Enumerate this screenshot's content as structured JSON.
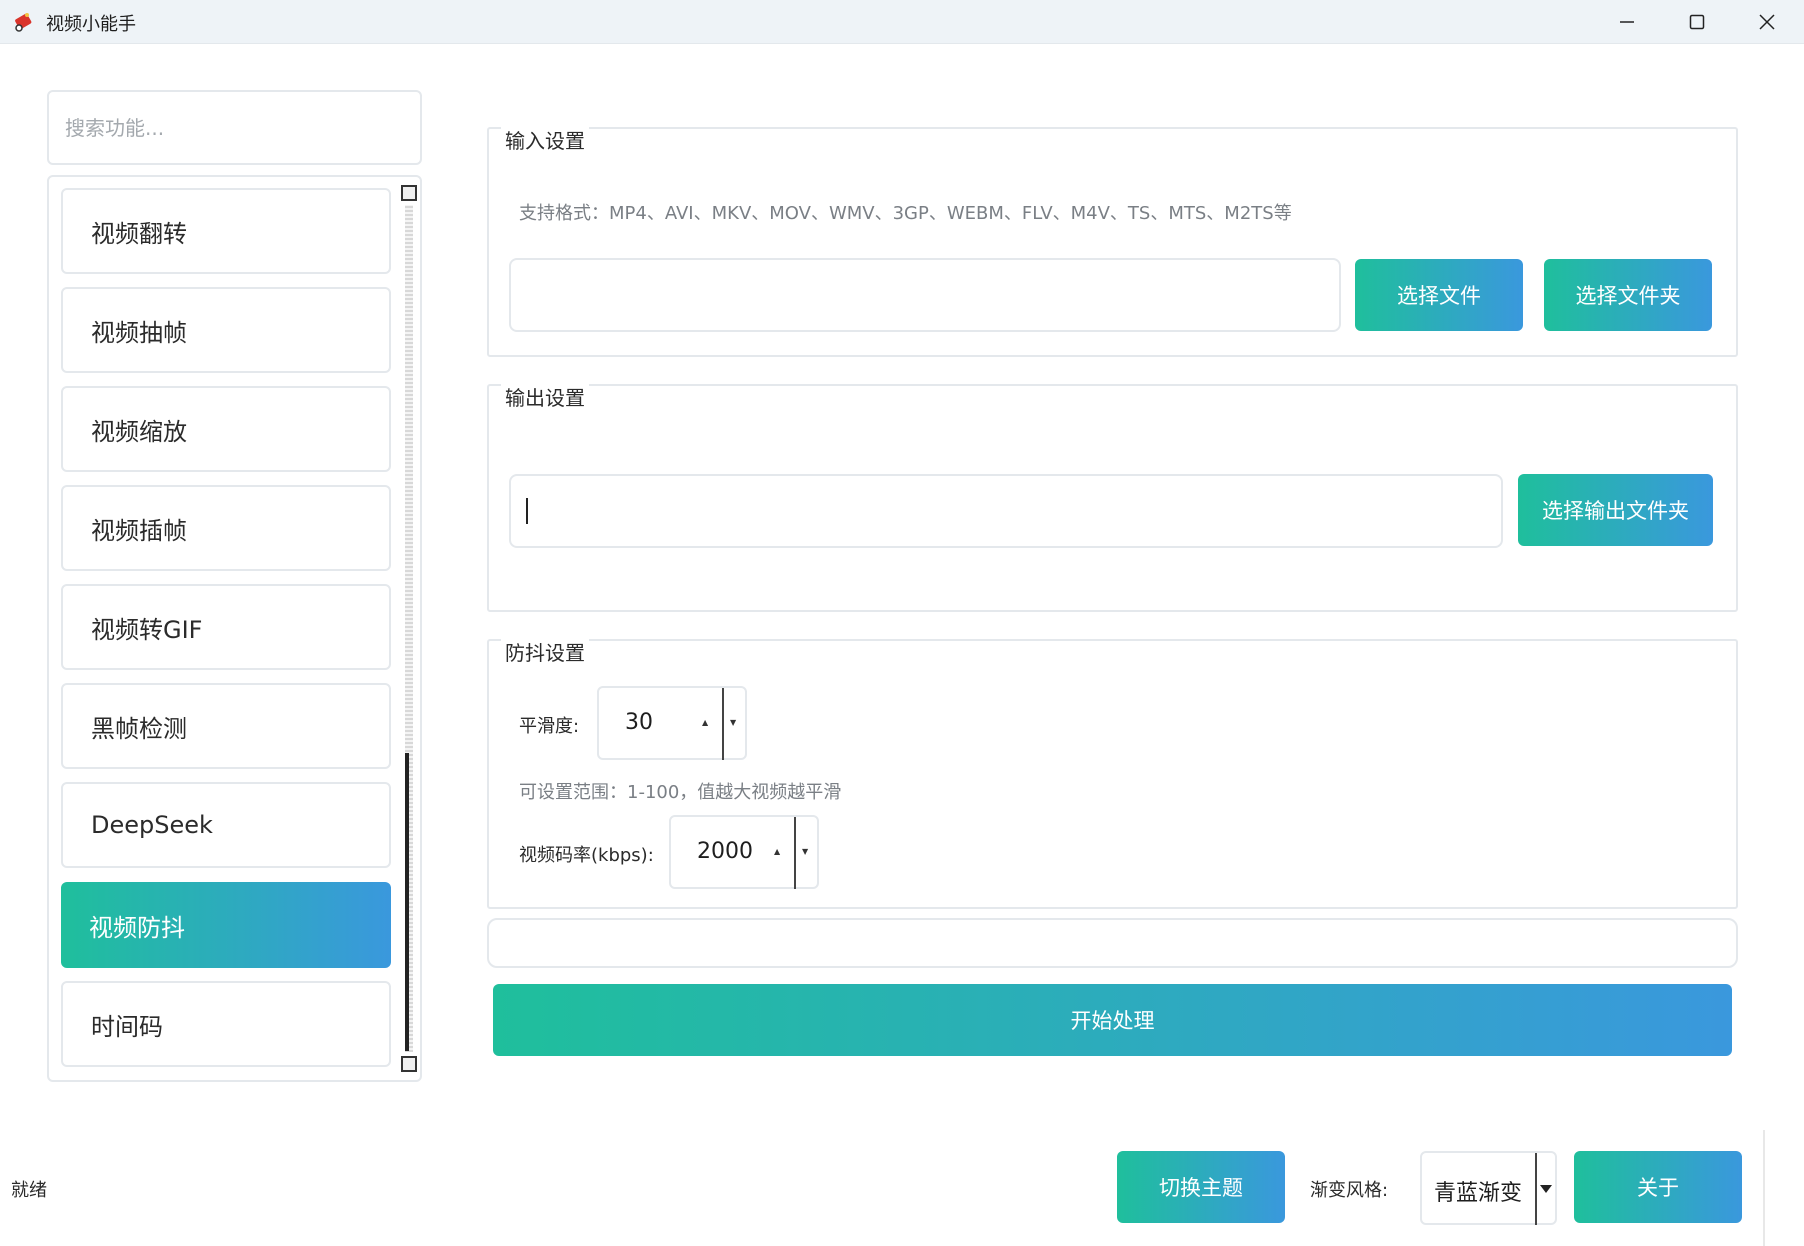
{
  "window": {
    "title": "视频小能手"
  },
  "search": {
    "placeholder": "搜索功能..."
  },
  "sidebar": {
    "items": [
      {
        "label": "视频翻转",
        "active": false
      },
      {
        "label": "视频抽帧",
        "active": false
      },
      {
        "label": "视频缩放",
        "active": false
      },
      {
        "label": "视频插帧",
        "active": false
      },
      {
        "label": "视频转GIF",
        "active": false
      },
      {
        "label": "黑帧检测",
        "active": false
      },
      {
        "label": "DeepSeek",
        "active": false
      },
      {
        "label": "视频防抖",
        "active": true
      },
      {
        "label": "时间码",
        "active": false
      }
    ]
  },
  "input_settings": {
    "title": "输入设置",
    "formats_hint": "支持格式：MP4、AVI、MKV、MOV、WMV、3GP、WEBM、FLV、M4V、TS、MTS、M2TS等",
    "path_value": "",
    "select_file_label": "选择文件",
    "select_folder_label": "选择文件夹"
  },
  "output_settings": {
    "title": "输出设置",
    "path_value": "",
    "select_output_folder_label": "选择输出文件夹"
  },
  "stabilize_settings": {
    "title": "防抖设置",
    "smoothness_label": "平滑度:",
    "smoothness_value": "30",
    "smoothness_hint": "可设置范围：1-100，值越大视频越平滑",
    "bitrate_label": "视频码率(kbps):",
    "bitrate_value": "2000"
  },
  "actions": {
    "start_label": "开始处理"
  },
  "footer": {
    "status": "就绪",
    "switch_theme_label": "切换主题",
    "gradient_style_label": "渐变风格:",
    "gradient_style_value": "青蓝渐变",
    "about_label": "关于"
  },
  "colors": {
    "gradient_start": "#1fbf9c",
    "gradient_end": "#3a98dd",
    "border": "#e4e8ec",
    "titlebar_bg": "#eef3f7"
  }
}
